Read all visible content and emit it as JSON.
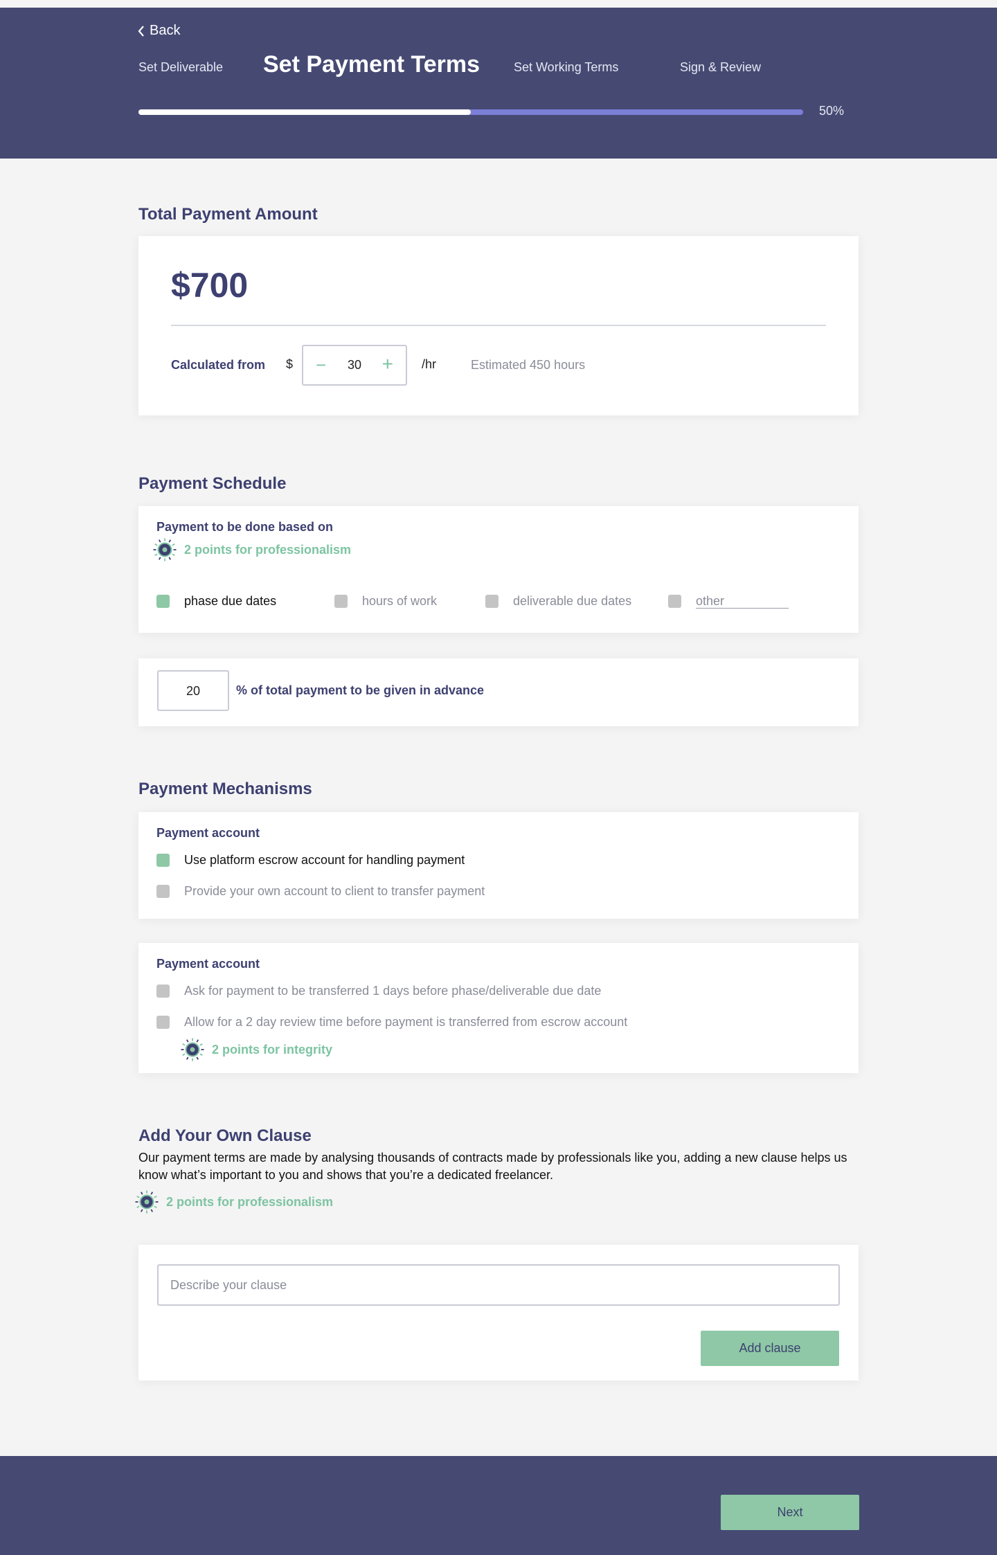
{
  "header": {
    "back_label": "Back",
    "steps": [
      {
        "label": "Set Deliverable"
      },
      {
        "label": "Set Payment Terms"
      },
      {
        "label": "Set Working Terms"
      },
      {
        "label": "Sign & Review"
      }
    ],
    "active_step": 1,
    "progress": 0.5,
    "progress_label": "50%"
  },
  "total_payment": {
    "title": "Total Payment Amount",
    "amount": "$700",
    "calc_label": "Calculated from",
    "currency": "$",
    "rate": "30",
    "minus": "−",
    "plus": "+",
    "unit": "/hr",
    "estimate": "Estimated 450 hours"
  },
  "schedule": {
    "title": "Payment Schedule",
    "based_on_label": "Payment to be done based on",
    "points": "2 points for professionalism",
    "options": [
      {
        "label": "phase due dates",
        "checked": true
      },
      {
        "label": "hours of work",
        "checked": false
      },
      {
        "label": "deliverable due dates",
        "checked": false
      },
      {
        "label": "other",
        "checked": false
      }
    ],
    "advance_value": "20",
    "advance_label": "% of total payment to be given in advance"
  },
  "mechanisms": {
    "title": "Payment Mechanisms",
    "account1_label": "Payment account",
    "account1_options": [
      {
        "label": "Use platform escrow account for handling payment",
        "checked": true
      },
      {
        "label": "Provide your own account to client to transfer payment",
        "checked": false
      }
    ],
    "account2_label": "Payment account",
    "account2_options": [
      {
        "label": "Ask for payment to be transferred 1 days before phase/deliverable due date",
        "checked": false
      },
      {
        "label": "Allow for a 2 day review time before payment is transferred from escrow account",
        "checked": false
      }
    ],
    "points": "2 points for integrity"
  },
  "clause": {
    "title": "Add Your Own Clause",
    "description": "Our payment terms are made by analysing thousands of contracts made by professionals like you, adding a new clause helps us know what’s important to you and shows that you’re a dedicated freelancer.",
    "points": "2 points for professionalism",
    "input_placeholder": "Describe your clause",
    "add_button": "Add clause"
  },
  "footer": {
    "next_button": "Next"
  },
  "colors": {
    "header_bg": "#464a73",
    "accent_green": "#8ec8a6",
    "progress_track": "#7b7fd6",
    "title_navy": "#3d4070"
  },
  "icons": {
    "back": "chevron-left-icon",
    "badge": "sun-badge-icon"
  }
}
